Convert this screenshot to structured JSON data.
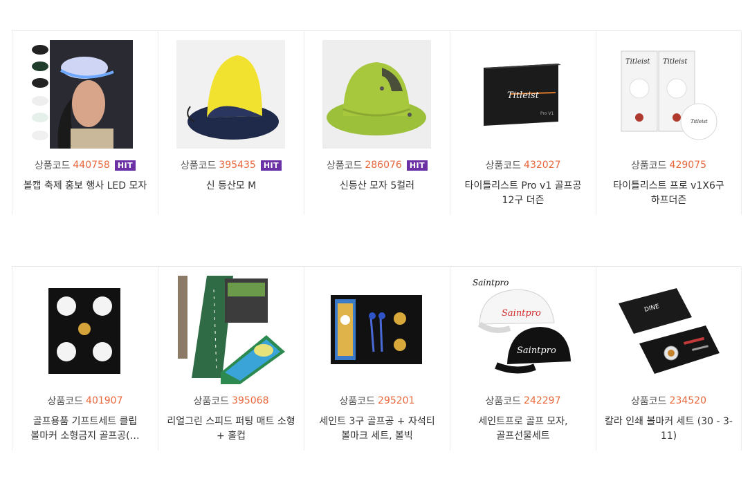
{
  "hit_label": "HIT",
  "code_label": "상품코드",
  "products": [
    {
      "code": "440758",
      "hit": true,
      "title": "볼캡 축제 홍보 행사 LED 모자",
      "image": "led-cap-photo"
    },
    {
      "code": "395435",
      "hit": true,
      "title": "신 등산모 M",
      "image": "yellow-hiking-hat-photo"
    },
    {
      "code": "286076",
      "hit": true,
      "title": "신등산 모자 5컬러",
      "image": "green-bucket-hat-photo"
    },
    {
      "code": "432027",
      "hit": false,
      "title": "타이틀리스트 Pro v1 골프공 12구 더즌",
      "image": "titleist-prov1-box-photo"
    },
    {
      "code": "429075",
      "hit": false,
      "title": "타이틀리스트 프로 v1X6구 하프더즌",
      "image": "titleist-prov1x-halfdozen-photo"
    },
    {
      "code": "401907",
      "hit": false,
      "title": "골프용품 기프트세트 클립 볼마커 소형금지 골프공(…",
      "image": "golf-gift-set-photo"
    },
    {
      "code": "395068",
      "hit": false,
      "title": "리얼그린 스피드 퍼팅 매트 소형 + 홀컵",
      "image": "putting-mat-photo"
    },
    {
      "code": "295201",
      "hit": false,
      "title": "세인트 3구 골프공 + 자석티 볼마크 세트, 볼빅",
      "image": "golf-ball-tee-set-photo"
    },
    {
      "code": "242297",
      "hit": false,
      "title": "세인트프로 골프 모자, 골프선물세트",
      "image": "saintpro-caps-photo"
    },
    {
      "code": "234520",
      "hit": false,
      "title": "칼라 인쇄 볼마커 세트 (30 - 3- 11)",
      "image": "ball-marker-set-photo"
    }
  ]
}
